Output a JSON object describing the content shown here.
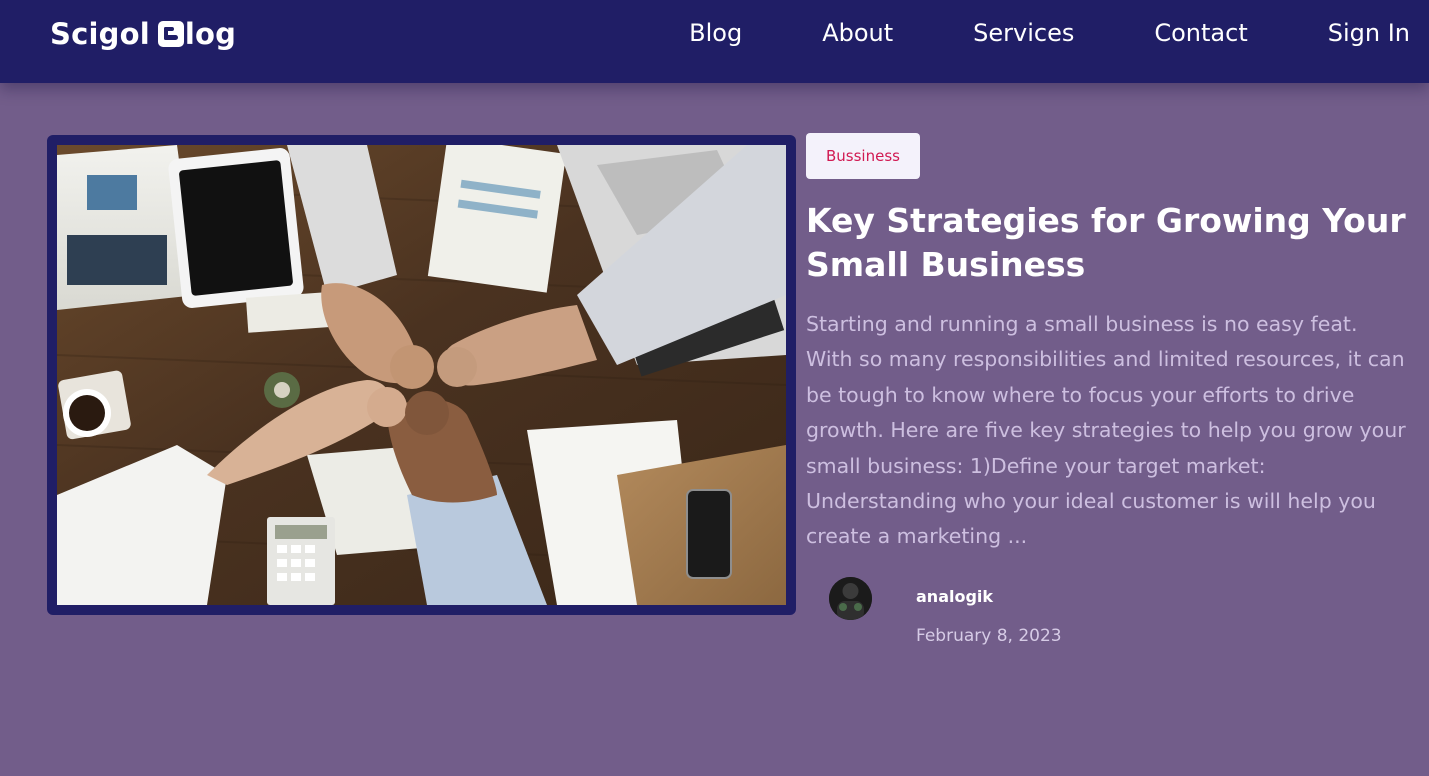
{
  "header": {
    "logo_left": "Scigol",
    "logo_icon": "blogger-b-icon",
    "logo_right": "log",
    "nav": [
      {
        "label": "Blog"
      },
      {
        "label": "About"
      },
      {
        "label": "Services"
      },
      {
        "label": "Contact"
      },
      {
        "label": "Sign In"
      }
    ]
  },
  "post": {
    "image_description": "business-team-fist-bump-photo",
    "category": "Bussiness",
    "title": "Key Strategies for Growing Your Small Business",
    "excerpt": "Starting and running a small business is no easy feat. With so many responsibilities and limited resources, it can be tough to know where to focus your efforts to drive growth. Here are five key strategies to help you grow your small business: 1)Define your target market: Understanding who your ideal customer is will help you create a marketing ...",
    "author": "analogik",
    "date": "February 8, 2023"
  },
  "colors": {
    "header_bg": "#201e66",
    "page_bg": "#725d8a",
    "badge_bg": "#f4f2fb",
    "badge_text": "#d11a52",
    "excerpt_text": "#cdbfe0"
  }
}
